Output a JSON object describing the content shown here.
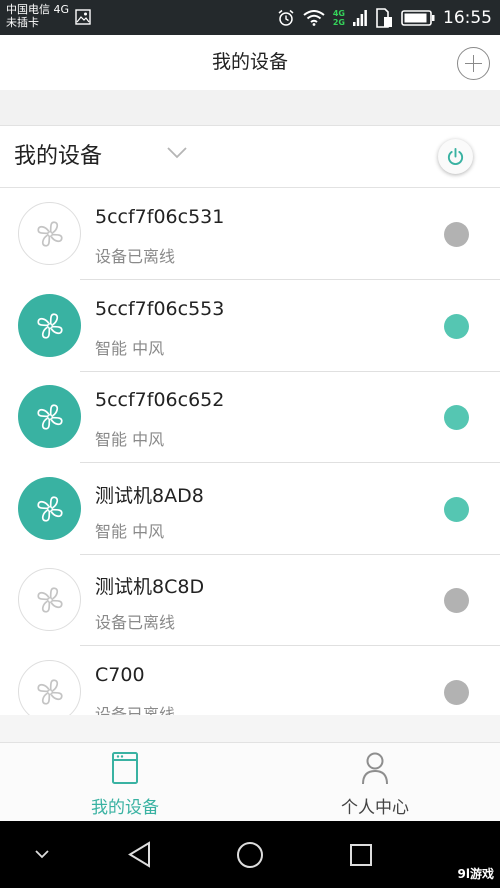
{
  "status_bar": {
    "carrier_line1": "中国电信 4G",
    "carrier_line2": "未插卡",
    "net_top": "4G",
    "net_bottom": "2G",
    "time": "16:55"
  },
  "header": {
    "title": "我的设备",
    "add_icon": "plus-circle-icon"
  },
  "section": {
    "title": "我的设备",
    "expand_icon": "chevron-down-icon",
    "power_icon": "power-icon"
  },
  "colors": {
    "accent": "#39b2a2",
    "online_dot": "#55c6b2",
    "offline_dot": "#b2b2b2"
  },
  "devices": [
    {
      "name": "5ccf7f06c531",
      "status": "设备已离线",
      "online": false
    },
    {
      "name": "5ccf7f06c553",
      "status": "智能 中风",
      "online": true
    },
    {
      "name": "5ccf7f06c652",
      "status": "智能 中风",
      "online": true
    },
    {
      "name": "测试机8AD8",
      "status": "智能 中风",
      "online": true
    },
    {
      "name": "测试机8C8D",
      "status": "设备已离线",
      "online": false
    },
    {
      "name": "C700",
      "status": "设备已离线",
      "online": false
    }
  ],
  "tabs": [
    {
      "label": "我的设备",
      "icon": "device-icon",
      "active": true
    },
    {
      "label": "个人中心",
      "icon": "person-icon",
      "active": false
    }
  ],
  "watermark": "9l游戏"
}
